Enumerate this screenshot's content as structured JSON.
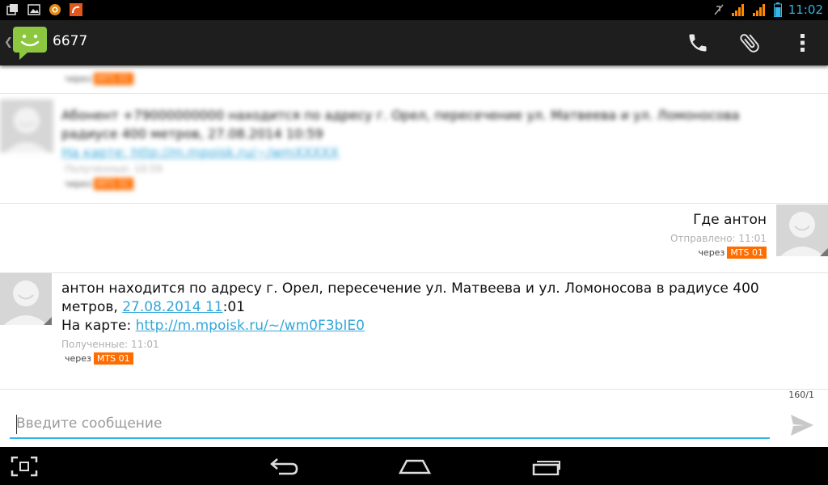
{
  "status_bar": {
    "time": "11:02"
  },
  "action_bar": {
    "title": "6677"
  },
  "messages": {
    "blurred_top": {
      "via": "через",
      "sim": "MTS 01"
    },
    "blurred_msg": {
      "line1": "Абонент +79000000000 находится по адресу г. Орел, пересечение ул. Матвеева и ул. Ломоносова",
      "line2": "радиусе 400 метров, 27.08.2014 10:59",
      "line3": "На карте: http://m.mpoisk.ru/~/wmXXXXX",
      "meta": "Полученные: 10:59",
      "via": "через",
      "sim": "MTS 01"
    },
    "sent": {
      "text": "Где антон",
      "meta": "Отправлено: 11:01",
      "via": "через",
      "sim": "MTS 01"
    },
    "received": {
      "text_part1": "антон находится по адресу г. Орел, пересечение ул. Матвеева и ул. Ломоносова в радиусе 400",
      "text_part2_prefix": "метров, ",
      "date_link": "27.08.2014 11",
      "text_part2_suffix": ":01",
      "map_label": "На карте: ",
      "map_link": "http://m.mpoisk.ru/~/wm0F3bIE0",
      "meta": "Полученные: 11:01",
      "via": "через",
      "sim": "MTS 01"
    }
  },
  "compose": {
    "counter": "160/1",
    "placeholder": "Введите сообщение"
  },
  "colors": {
    "accent": "#33b5e5",
    "sim_badge": "#ff6d00",
    "messaging_green": "#8dc63f"
  }
}
